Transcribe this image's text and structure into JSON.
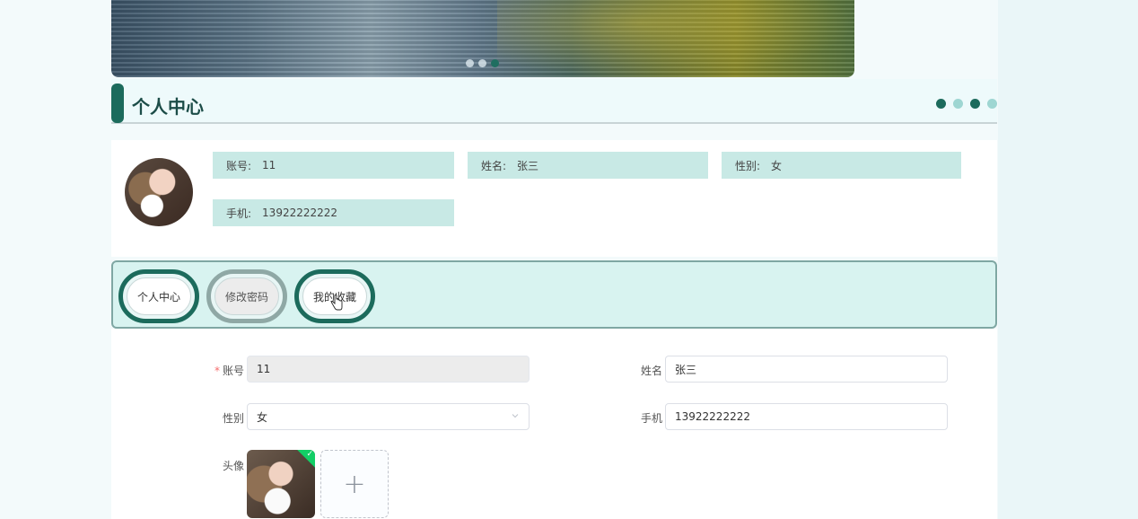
{
  "banner": {
    "dots": [
      false,
      false,
      true
    ]
  },
  "section": {
    "title": "个人中心"
  },
  "profile": {
    "account_label": "账号:",
    "account_value": "11",
    "name_label": "姓名:",
    "name_value": "张三",
    "gender_label": "性别:",
    "gender_value": "女",
    "phone_label": "手机:",
    "phone_value": "13922222222"
  },
  "tabs": [
    {
      "label": "个人中心"
    },
    {
      "label": "修改密码"
    },
    {
      "label": "我的收藏"
    }
  ],
  "form": {
    "account_label": "账号",
    "account_value": "11",
    "name_label": "姓名",
    "name_value": "张三",
    "gender_label": "性别",
    "gender_value": "女",
    "phone_label": "手机",
    "phone_value": "13922222222",
    "avatar_label": "头像",
    "upload_plus": "+"
  },
  "colors": {
    "accent": "#1c6b5c",
    "chip_bg": "#c8e9e5",
    "tab_bg": "#d8f3f0"
  }
}
